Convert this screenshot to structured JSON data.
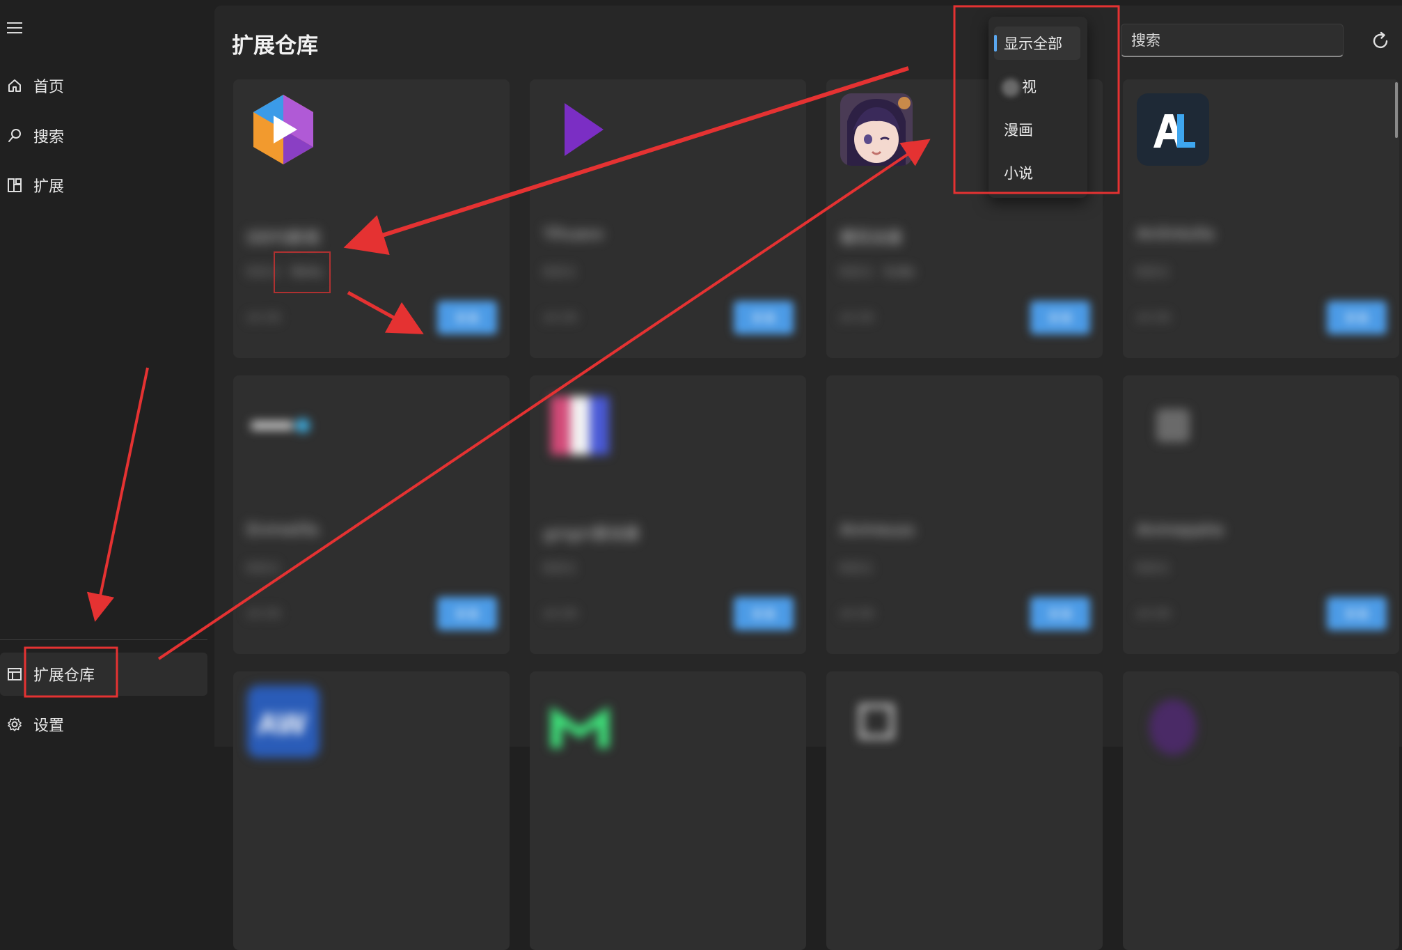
{
  "sidebar": {
    "items": [
      {
        "label": "首页",
        "icon": "home-icon"
      },
      {
        "label": "搜索",
        "icon": "search-icon"
      },
      {
        "label": "扩展",
        "icon": "extensions-icon"
      }
    ],
    "footer": [
      {
        "label": "扩展仓库",
        "icon": "repository-icon",
        "active": true
      },
      {
        "label": "设置",
        "icon": "gear-icon"
      }
    ]
  },
  "main": {
    "title": "扩展仓库",
    "search": {
      "placeholder": "搜索",
      "value": ""
    },
    "filter": {
      "options": [
        "显示全部",
        "视",
        "漫画",
        "小说"
      ],
      "selected": "显示全部"
    }
  },
  "cards": [
    {
      "name": "DDYS影视",
      "version": "0.0.1 · 9b4a",
      "lang": "zh-CN",
      "action": "安装"
    },
    {
      "name": "Yihuaxx",
      "version": "0.0.1",
      "lang": "zh-CN",
      "action": "安装"
    },
    {
      "name": "樱花动漫",
      "version": "0.0.1 · 5c8e",
      "lang": "zh-CN",
      "action": "安装"
    },
    {
      "name": "Anilinkzlla",
      "version": "0.0.1",
      "lang": "zh-CN",
      "action": "安装"
    },
    {
      "name": "Enimelifa",
      "version": "0.0.1",
      "lang": "zh-CN",
      "action": "安装"
    },
    {
      "name": "girigiri爱动漫",
      "version": "0.0.1",
      "lang": "zh-CN",
      "action": "安装"
    },
    {
      "name": "Animeuss",
      "version": "0.0.1",
      "lang": "zh-CN",
      "action": "安装"
    },
    {
      "name": "Animepahe",
      "version": "0.0.1",
      "lang": "zh-CN",
      "action": "安装"
    }
  ],
  "colors": {
    "accent": "#4c9be6",
    "annotation": "#e53232",
    "background": "#202020",
    "card": "#2f2f2f"
  }
}
